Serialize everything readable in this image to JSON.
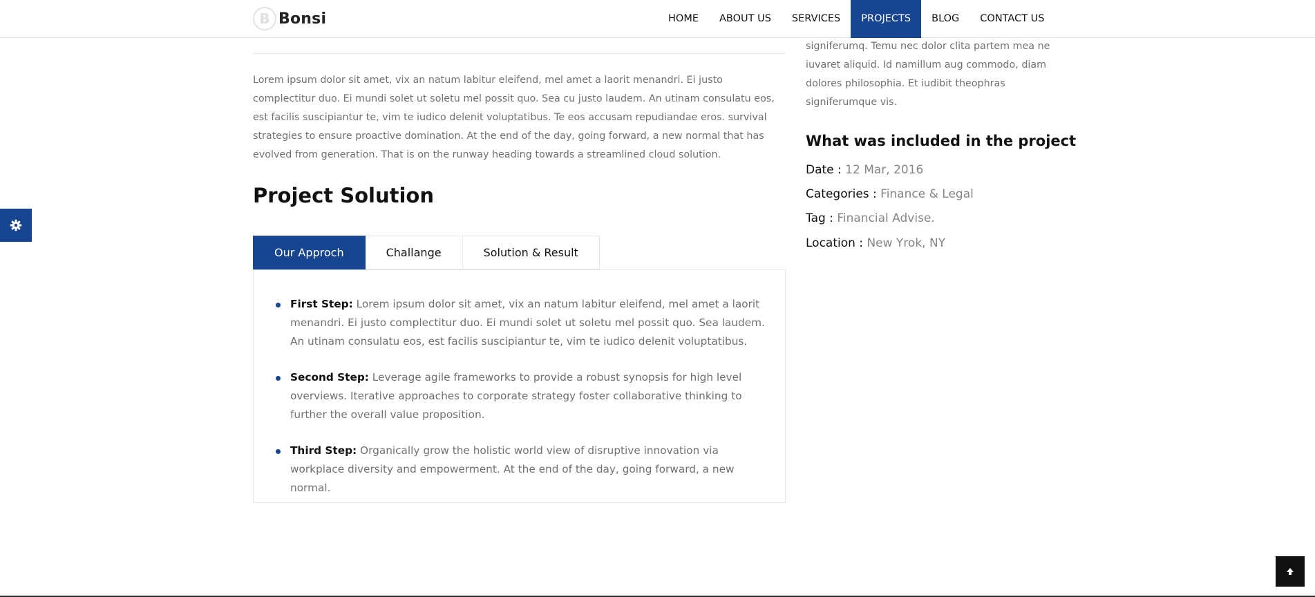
{
  "brand": {
    "logo_letter": "B",
    "name": "Bonsi"
  },
  "nav": {
    "items": [
      {
        "label": "HOME"
      },
      {
        "label": "ABOUT US"
      },
      {
        "label": "SERVICES"
      },
      {
        "label": "PROJECTS"
      },
      {
        "label": "BLOG"
      },
      {
        "label": "CONTACT US"
      }
    ],
    "active": "PROJECTS"
  },
  "main": {
    "intro": "Lorem ipsum dolor sit amet, vix an natum labitur eleifend, mel amet a laorit menandri. Ei justo complectitur duo. Ei mundi solet ut soletu mel possit quo. Sea cu justo laudem. An utinam consulatu eos, est facilis suscipiantur te, vim te iudico delenit voluptatibus. Te eos accusam repudiandae eros. survival strategies to ensure proactive domination. At the end of the day, going forward, a new normal that has evolved from generation. That is on the runway heading towards a streamlined cloud solution.",
    "solution_title": "Project Solution",
    "tabs": [
      {
        "label": "Our Approch"
      },
      {
        "label": "Challange"
      },
      {
        "label": "Solution & Result"
      }
    ],
    "active_tab": "Our Approch",
    "steps": [
      {
        "title": "First Step:",
        "text": "Lorem ipsum dolor sit amet, vix an natum labitur eleifend, mel amet a laorit menandri. Ei justo complectitur duo. Ei mundi solet ut soletu mel possit quo. Sea laudem. An utinam consulatu eos, est facilis suscipiantur te, vim te iudico delenit voluptatibus."
      },
      {
        "title": "Second Step:",
        "text": "Leverage agile frameworks to provide a robust synopsis for high level overviews. Iterative approaches to corporate strategy foster collaborative thinking to further the overall value proposition."
      },
      {
        "title": "Third Step:",
        "text": "Organically grow the holistic world view of disruptive innovation via workplace diversity and empowerment. At the end of the day, going forward, a new normal."
      }
    ]
  },
  "sidebar": {
    "text": "signiferumq. Temu nec dolor clita partem mea ne iuvaret aliquid. Id namillum aug commodo, diam dolores philosophia. Et iudibit theophras signiferumque vis.",
    "included_title": "What was included in the project",
    "meta": [
      {
        "key": "Date :",
        "value": "12 Mar, 2016"
      },
      {
        "key": "Categories :",
        "value": "Finance & Legal"
      },
      {
        "key": "Tag :",
        "value": "Financial Advise."
      },
      {
        "key": "Location :",
        "value": "New Yrok, NY"
      }
    ]
  },
  "icons": {
    "settings": "gear-icon",
    "scroll_top": "arrow-up-icon"
  },
  "colors": {
    "accent": "#17458f",
    "heading": "#111111",
    "body_text": "#707070",
    "meta_value": "#858585"
  }
}
